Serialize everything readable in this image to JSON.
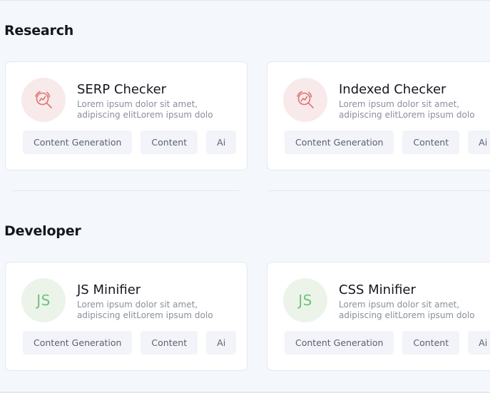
{
  "colors": {
    "background": "#f4f7fb",
    "card": "#ffffff",
    "research_icon_bg": "#f8eaea",
    "research_icon": "#e07070",
    "developer_icon_bg": "#ecf4ea",
    "developer_icon": "#6cc27a",
    "tag_bg": "#f2f4f9"
  },
  "sections": [
    {
      "title": "Research",
      "cards": [
        {
          "icon": "search-analytics-icon",
          "title": "SERP Checker",
          "description": "Lorem ipsum dolor sit amet, adipiscing elitLorem ipsum dolo",
          "tags": [
            "Content Generation",
            "Content",
            "Ai"
          ]
        },
        {
          "icon": "search-analytics-icon",
          "title": "Indexed Checker",
          "description": "Lorem ipsum dolor sit amet, adipiscing elitLorem ipsum dolo",
          "tags": [
            "Content Generation",
            "Content",
            "Ai"
          ]
        }
      ]
    },
    {
      "title": "Developer",
      "cards": [
        {
          "icon_text": "JS",
          "title": "JS Minifier",
          "description": "Lorem ipsum dolor sit amet, adipiscing elitLorem ipsum dolo",
          "tags": [
            "Content Generation",
            "Content",
            "Ai"
          ]
        },
        {
          "icon_text": "JS",
          "title": "CSS Minifier",
          "description": "Lorem ipsum dolor sit amet, adipiscing elitLorem ipsum dolo",
          "tags": [
            "Content Generation",
            "Content",
            "Ai"
          ]
        }
      ]
    }
  ]
}
